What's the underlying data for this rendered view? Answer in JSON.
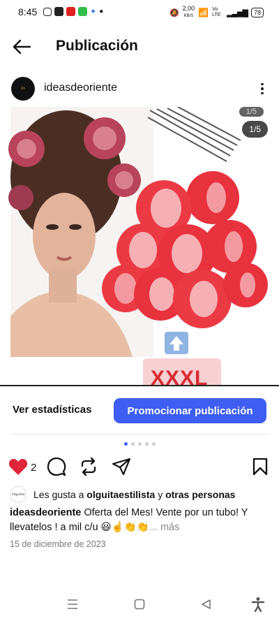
{
  "status_bar": {
    "time": "8:45",
    "net_speed": "2,00",
    "net_unit": "KB/S",
    "volte": "Vo LTE",
    "battery": "78"
  },
  "header": {
    "title": "Publicación"
  },
  "post": {
    "username": "ideasdeoriente",
    "avatar_text": "ID",
    "image_counter": "1/5",
    "image_counter_back": "1/5",
    "image_text": "XXXL"
  },
  "actions": {
    "stats_label": "Ver estadísticas",
    "promote_label": "Promocionar publicación"
  },
  "engagement": {
    "like_count": "2",
    "likes_prefix": "Les gusta a ",
    "likes_user": "olguitaestilista",
    "likes_middle": " y ",
    "likes_others": "otras personas",
    "liker_avatar_text": "Olguita"
  },
  "caption": {
    "username": "ideasdeoriente",
    "text": " Oferta del Mes! Vente  por un tubo! Y llevatelos ! a mil c/u 😃☝️👏👏",
    "more": "... más"
  },
  "date": "15 de diciembre de 2023",
  "colors": {
    "accent": "#3d5ef0",
    "like": "#e0243a",
    "roller": "#e8323e"
  },
  "icons": {
    "back": "arrow-left-icon",
    "more": "more-vertical-icon",
    "like": "heart-icon",
    "comment": "comment-icon",
    "repost": "repost-icon",
    "share": "send-icon",
    "save": "bookmark-icon",
    "nav_menu": "menu-icon",
    "nav_home": "home-icon",
    "nav_back": "back-triangle-icon",
    "accessibility": "accessibility-icon"
  }
}
